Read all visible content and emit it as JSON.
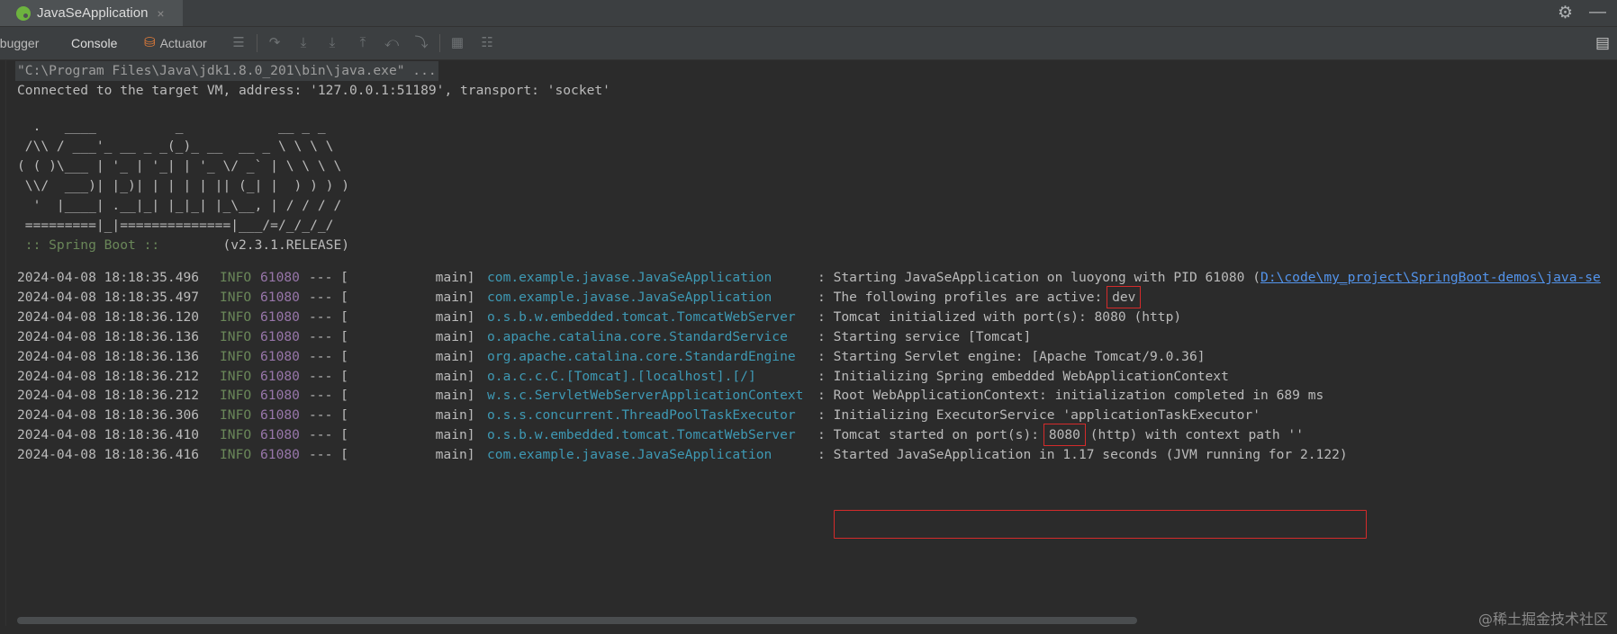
{
  "title_bar": {
    "run_tab_label": "JavaSeApplication",
    "close_glyph": "×",
    "settings_icon": "gear-icon",
    "minimize_icon": "minimize-icon"
  },
  "toolbar": {
    "debugger_label": "ebugger",
    "console_label": "Console",
    "actuator_label": "Actuator"
  },
  "console": {
    "command_line": "\"C:\\Program Files\\Java\\jdk1.8.0_201\\bin\\java.exe\" ...",
    "connected_line": "Connected to the target VM, address: '127.0.0.1:51189', transport: 'socket'",
    "banner": [
      "  .   ____          _            __ _ _",
      " /\\\\ / ___'_ __ _ _(_)_ __  __ _ \\ \\ \\ \\",
      "( ( )\\___ | '_ | '_| | '_ \\/ _` | \\ \\ \\ \\",
      " \\\\/  ___)| |_)| | | | | || (_| |  ) ) ) )",
      "  '  |____| .__|_| |_|_| |_\\__, | / / / /",
      " =========|_|==============|___/=/_/_/_/"
    ],
    "spring_boot_label": " :: Spring Boot :: ",
    "spring_boot_version": "       (v2.3.1.RELEASE)",
    "logs": [
      {
        "ts": "2024-04-08 18:18:35.496",
        "level": "INFO",
        "pid": "61080",
        "sep": "--- [",
        "thread": "           main]",
        "logger": "com.example.javase.JavaSeApplication",
        "msg_pre": ": Starting JavaSeApplication on luoyong with PID 61080 (",
        "msg_link": "D:\\code\\my_project\\SpringBoot-demos\\java-se",
        "msg_hl": "",
        "msg_post": ""
      },
      {
        "ts": "2024-04-08 18:18:35.497",
        "level": "INFO",
        "pid": "61080",
        "sep": "--- [",
        "thread": "           main]",
        "logger": "com.example.javase.JavaSeApplication",
        "msg_pre": ": The following profiles are active: ",
        "msg_link": "",
        "msg_hl": "dev",
        "msg_post": ""
      },
      {
        "ts": "2024-04-08 18:18:36.120",
        "level": "INFO",
        "pid": "61080",
        "sep": "--- [",
        "thread": "           main]",
        "logger": "o.s.b.w.embedded.tomcat.TomcatWebServer",
        "msg_pre": ": Tomcat initialized with port(s): 8080 (http)",
        "msg_link": "",
        "msg_hl": "",
        "msg_post": ""
      },
      {
        "ts": "2024-04-08 18:18:36.136",
        "level": "INFO",
        "pid": "61080",
        "sep": "--- [",
        "thread": "           main]",
        "logger": "o.apache.catalina.core.StandardService",
        "msg_pre": ": Starting service [Tomcat]",
        "msg_link": "",
        "msg_hl": "",
        "msg_post": ""
      },
      {
        "ts": "2024-04-08 18:18:36.136",
        "level": "INFO",
        "pid": "61080",
        "sep": "--- [",
        "thread": "           main]",
        "logger": "org.apache.catalina.core.StandardEngine",
        "msg_pre": ": Starting Servlet engine: [Apache Tomcat/9.0.36]",
        "msg_link": "",
        "msg_hl": "",
        "msg_post": ""
      },
      {
        "ts": "2024-04-08 18:18:36.212",
        "level": "INFO",
        "pid": "61080",
        "sep": "--- [",
        "thread": "           main]",
        "logger": "o.a.c.c.C.[Tomcat].[localhost].[/]",
        "msg_pre": ": Initializing Spring embedded WebApplicationContext",
        "msg_link": "",
        "msg_hl": "",
        "msg_post": ""
      },
      {
        "ts": "2024-04-08 18:18:36.212",
        "level": "INFO",
        "pid": "61080",
        "sep": "--- [",
        "thread": "           main]",
        "logger": "w.s.c.ServletWebServerApplicationContext",
        "msg_pre": ": Root WebApplicationContext: initialization completed in 689 ms",
        "msg_link": "",
        "msg_hl": "",
        "msg_post": ""
      },
      {
        "ts": "2024-04-08 18:18:36.306",
        "level": "INFO",
        "pid": "61080",
        "sep": "--- [",
        "thread": "           main]",
        "logger": "o.s.s.concurrent.ThreadPoolTaskExecutor",
        "msg_pre": ": Initializing ExecutorService 'applicationTaskExecutor'",
        "msg_link": "",
        "msg_hl": "",
        "msg_post": ""
      },
      {
        "ts": "2024-04-08 18:18:36.410",
        "level": "INFO",
        "pid": "61080",
        "sep": "--- [",
        "thread": "           main]",
        "logger": "o.s.b.w.embedded.tomcat.TomcatWebServer",
        "msg_pre": ": Tomcat started on port(s): ",
        "msg_link": "",
        "msg_hl": "8080",
        "msg_post": " (http) with context path ''"
      },
      {
        "ts": "2024-04-08 18:18:36.416",
        "level": "INFO",
        "pid": "61080",
        "sep": "--- [",
        "thread": "           main]",
        "logger": "com.example.javase.JavaSeApplication",
        "msg_pre": ": Started JavaSeApplication in 1.17 seconds (JVM running for 2.122)",
        "msg_link": "",
        "msg_hl": "",
        "msg_post": ""
      }
    ]
  },
  "watermark": "@稀土掘金技术社区",
  "colors": {
    "background": "#2b2b2b",
    "info_level": "#6a8759",
    "pid": "#9876aa",
    "logger": "#3e99b4",
    "link": "#5394ec",
    "highlight_box": "#d42b2b"
  }
}
